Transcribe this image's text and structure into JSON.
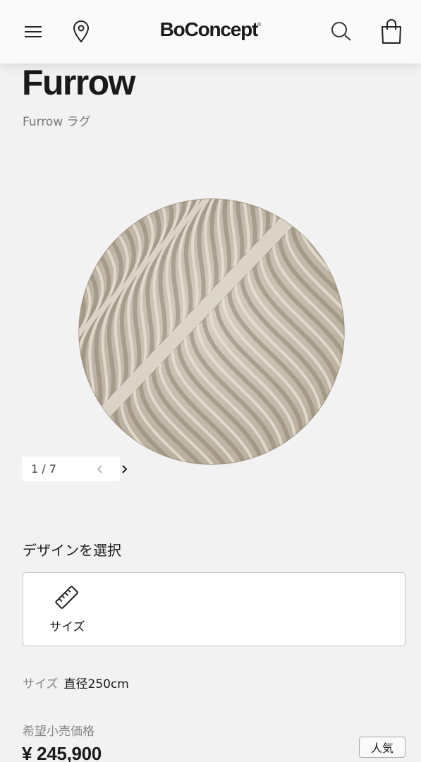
{
  "header": {
    "logo": "BoConcept",
    "logo_mark": "®",
    "icons": [
      "menu-icon",
      "location-pin-icon",
      "search-icon",
      "shopping-bag-icon"
    ]
  },
  "product": {
    "title": "Furrow",
    "subtitle": "Furrow ラグ"
  },
  "gallery": {
    "counter": "1 / 7",
    "current": 1,
    "total": 7
  },
  "design": {
    "section_title": "デザインを選択",
    "option_label": "サイズ",
    "option_icon": "ruler-icon"
  },
  "size_info": {
    "label": "サイズ",
    "value": "直径250cm"
  },
  "pricing": {
    "rrp_label": "希望小売価格",
    "price": "¥ 245,900",
    "badge": "人気"
  },
  "colors": {
    "background": "#f2f2f2",
    "header": "#fafafa",
    "text": "#1a1a1a",
    "muted": "#888888"
  }
}
